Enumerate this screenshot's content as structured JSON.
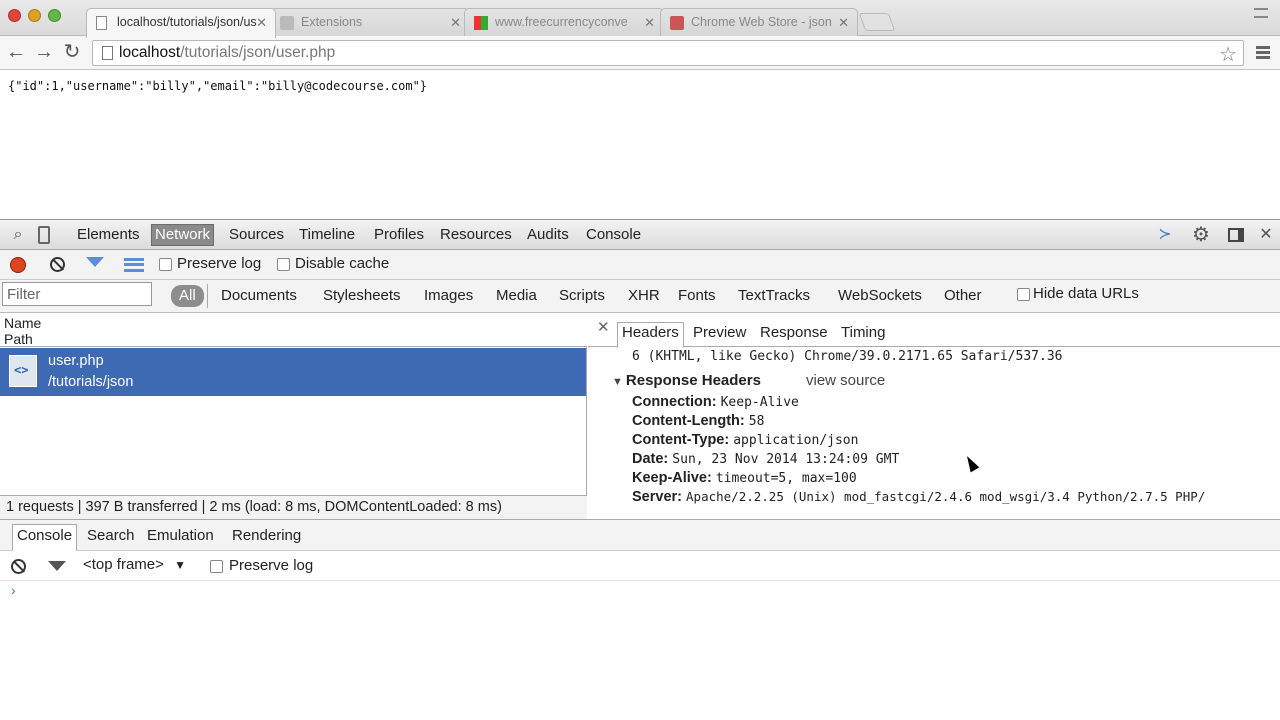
{
  "browser": {
    "tabs": [
      {
        "label": "localhost/tutorials/json/us",
        "active": true
      },
      {
        "label": "Extensions",
        "active": false
      },
      {
        "label": "www.freecurrencyconve",
        "active": false
      },
      {
        "label": "Chrome Web Store - json",
        "active": false
      }
    ],
    "url_host": "localhost",
    "url_path": "/tutorials/json/user.php"
  },
  "page": {
    "json_text": "{\"id\":1,\"username\":\"billy\",\"email\":\"billy@codecourse.com\"}"
  },
  "devtools": {
    "panels": [
      "Elements",
      "Network",
      "Sources",
      "Timeline",
      "Profiles",
      "Resources",
      "Audits",
      "Console"
    ],
    "active_panel": "Network",
    "network": {
      "preserve_log_label": "Preserve log",
      "disable_cache_label": "Disable cache",
      "filter_placeholder": "Filter",
      "types": [
        "All",
        "Documents",
        "Stylesheets",
        "Images",
        "Media",
        "Scripts",
        "XHR",
        "Fonts",
        "TextTracks",
        "WebSockets",
        "Other"
      ],
      "hide_data_urls_label": "Hide data URLs",
      "col_name": "Name",
      "col_path": "Path",
      "request": {
        "name": "user.php",
        "path": "/tutorials/json"
      },
      "summary": "1 requests | 397 B transferred | 2 ms (load: 8 ms, DOMContentLoaded: 8 ms)"
    },
    "details": {
      "tabs": [
        "Headers",
        "Preview",
        "Response",
        "Timing"
      ],
      "active_tab": "Headers",
      "ua_tail": "6 (KHTML, like Gecko) Chrome/39.0.2171.65 Safari/537.36",
      "section_title": "Response Headers",
      "view_source": "view source",
      "headers": [
        {
          "key": "Connection:",
          "value": "Keep-Alive"
        },
        {
          "key": "Content-Length:",
          "value": "58"
        },
        {
          "key": "Content-Type:",
          "value": "application/json"
        },
        {
          "key": "Date:",
          "value": "Sun, 23 Nov 2014 13:24:09 GMT"
        },
        {
          "key": "Keep-Alive:",
          "value": "timeout=5, max=100"
        },
        {
          "key": "Server:",
          "value": "Apache/2.2.25 (Unix) mod_fastcgi/2.4.6 mod_wsgi/3.4 Python/2.7.5 PHP/"
        }
      ]
    },
    "drawer": {
      "tabs": [
        "Console",
        "Search",
        "Emulation",
        "Rendering"
      ],
      "active_tab": "Console",
      "context": "<top frame>",
      "preserve_log_label": "Preserve log"
    }
  },
  "colors": {
    "selected_row": "#3d6ab2",
    "record_button": "#dd4422",
    "filter_blue": "#5a8ed8"
  }
}
